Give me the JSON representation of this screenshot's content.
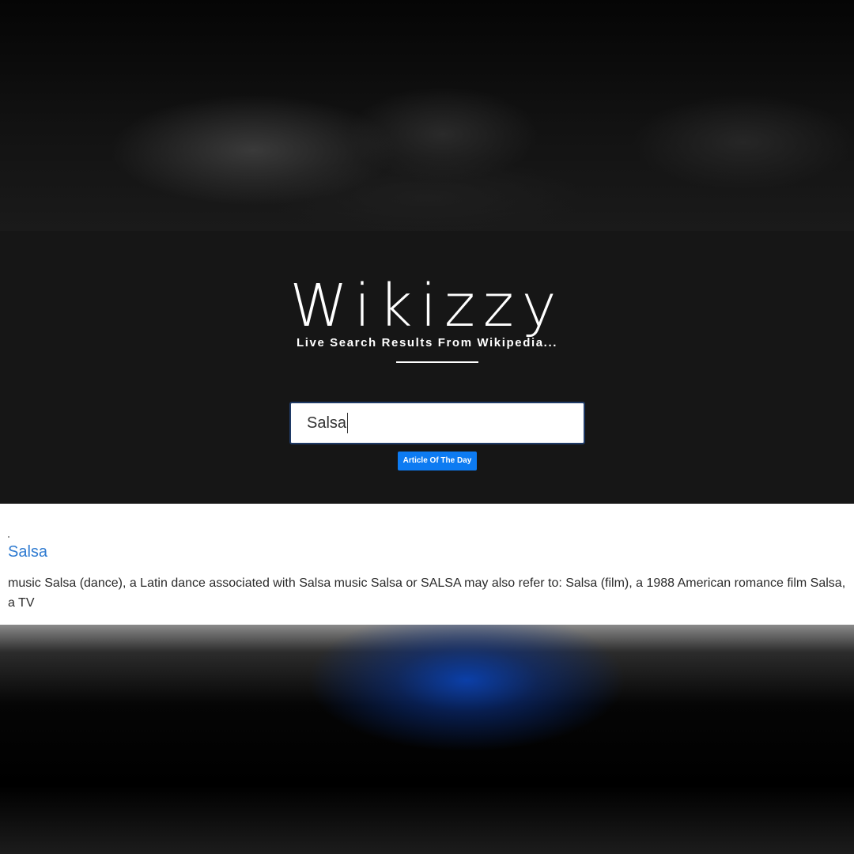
{
  "header": {
    "logo_text": "Wikizzy",
    "tagline": "Live Search Results From Wikipedia..."
  },
  "search": {
    "value": "Salsa",
    "placeholder": ""
  },
  "buttons": {
    "article_of_the_day": "Article Of The Day"
  },
  "results": [
    {
      "title": "Salsa",
      "snippet": "music Salsa (dance), a Latin dance associated with Salsa music Salsa or SALSA may also refer to: Salsa (film), a 1988 American romance film Salsa, a TV"
    }
  ],
  "colors": {
    "hero_background": "#161616",
    "button_accent": "#0d7bf2",
    "result_link": "#2f7bd1"
  }
}
